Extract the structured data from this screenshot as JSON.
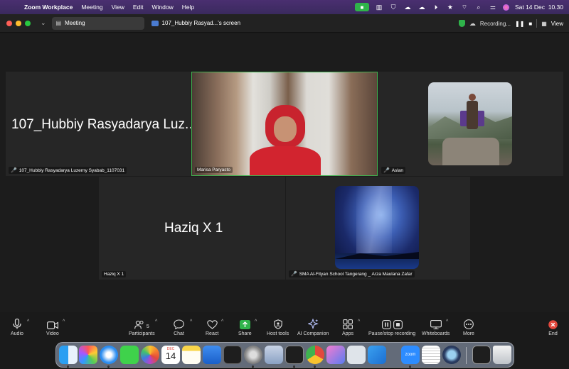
{
  "menubar": {
    "app_name": "Zoom Workplace",
    "items": [
      "Meeting",
      "View",
      "Edit",
      "Window",
      "Help"
    ],
    "datetime": "Sat 14 Dec  10.30"
  },
  "titlebar": {
    "tab_meeting": "Meeting",
    "tab_screen": "107_Hubbiy Rasyad...'s screen",
    "recording": "Recording...",
    "view": "View"
  },
  "participants": {
    "p1_display": "107_Hubbiy Rasyadarya Luz...",
    "p1_name": "107_Hubbiy Rasyadarya Luzerny Syabab_1107031",
    "p2_name": "Marisa Paryasto",
    "p3_name": "Aslan",
    "p4_display": "Haziq X 1",
    "p4_name": "Haziq X 1",
    "p5_name": "SMA Al-Fityan School Tangerang _ Arza Maulana Zafar"
  },
  "toolbar": {
    "audio": "Audio",
    "video": "Video",
    "participants": "Participants",
    "participants_count": "5",
    "chat": "Chat",
    "react": "React",
    "share": "Share",
    "host_tools": "Host tools",
    "ai_companion": "AI Companion",
    "apps": "Apps",
    "pause_recording": "Pause/stop recording",
    "whiteboards": "Whiteboards",
    "more": "More",
    "end": "End"
  },
  "dock": {
    "calendar_month": "DEC",
    "calendar_day": "14",
    "zoom_label": "zoom"
  },
  "colors": {
    "active_speaker_border": "#3fb24f",
    "menubar_bg": "#3d2c63",
    "end_red": "#e2483d",
    "share_green": "#2fb34a"
  }
}
